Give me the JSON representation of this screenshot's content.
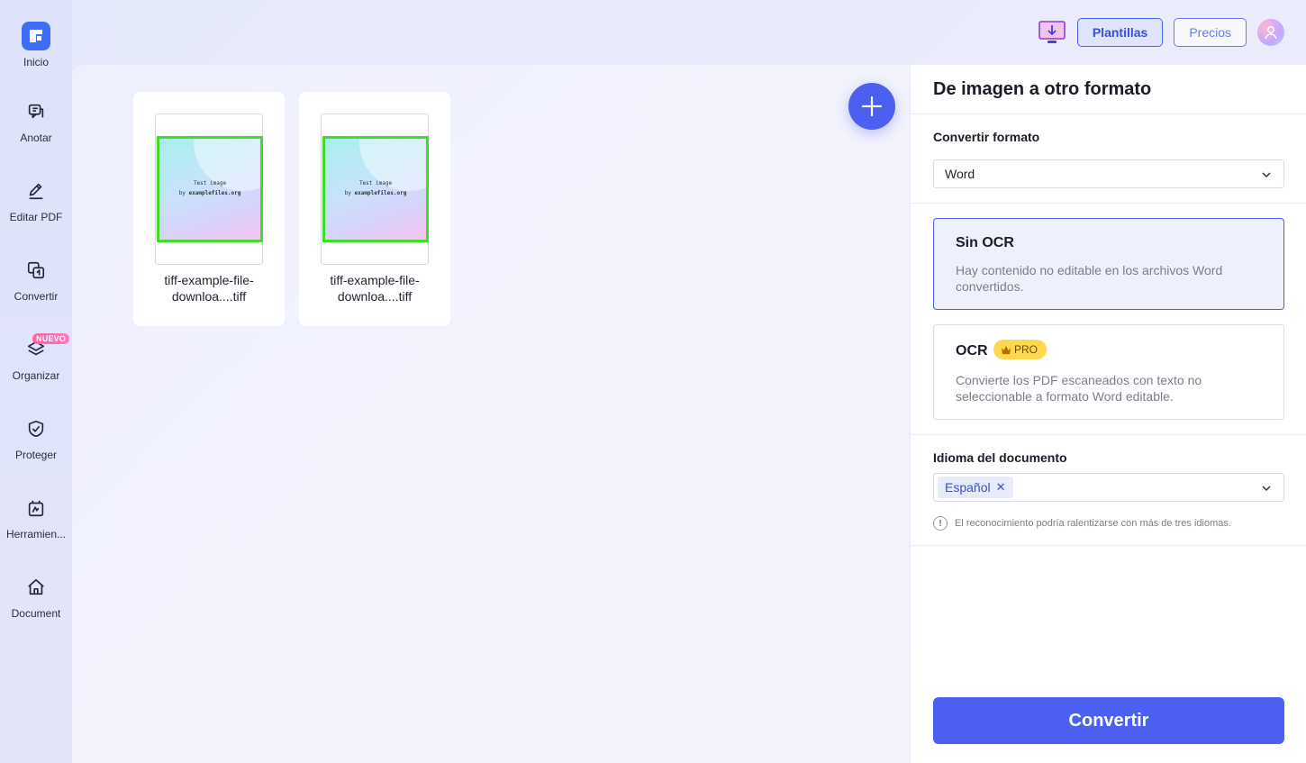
{
  "sidebar": {
    "items": [
      {
        "label": "Inicio",
        "icon": "home-logo-icon"
      },
      {
        "label": "Anotar",
        "icon": "annotate-icon"
      },
      {
        "label": "Editar PDF",
        "icon": "edit-icon"
      },
      {
        "label": "Convertir",
        "icon": "convert-icon"
      },
      {
        "label": "Organizar",
        "icon": "layers-icon",
        "badge": "NUEVO"
      },
      {
        "label": "Proteger",
        "icon": "shield-icon"
      },
      {
        "label": "Herramien...",
        "icon": "tools-icon"
      },
      {
        "label": "Document",
        "icon": "house-icon"
      }
    ]
  },
  "header": {
    "templates_label": "Plantillas",
    "pricing_label": "Precios"
  },
  "files": [
    {
      "name": "tiff-example-file-downloa....tiff",
      "name_line1": "tiff-example-file-",
      "name_line2": "downloa....tiff",
      "thumb_line1": "Test image",
      "thumb_line2_prefix": "by ",
      "thumb_line2_bold": "examplefiles.org"
    },
    {
      "name": "tiff-example-file-downloa....tiff",
      "name_line1": "tiff-example-file-",
      "name_line2": "downloa....tiff",
      "thumb_line1": "Test image",
      "thumb_line2_prefix": "by ",
      "thumb_line2_bold": "examplefiles.org"
    }
  ],
  "panel": {
    "title": "De imagen a otro formato",
    "format_label": "Convertir formato",
    "format_value": "Word",
    "options": [
      {
        "title": "Sin OCR",
        "desc": "Hay contenido no editable en los archivos Word convertidos.",
        "selected": true
      },
      {
        "title": "OCR",
        "badge": "PRO",
        "desc": "Convierte los PDF escaneados con texto no seleccionable a formato Word editable.",
        "selected": false
      }
    ],
    "language_label": "Idioma del documento",
    "language_tag": "Español",
    "language_hint": "El reconocimiento podría ralentizarse con más de tres idiomas.",
    "convert_label": "Convertir"
  },
  "colors": {
    "accent": "#4b5ff0",
    "logo": "#3f6df6",
    "thumb_border": "#41dd2a",
    "pro_badge": "#ffd84e",
    "new_badge": "#ff5fa2"
  }
}
